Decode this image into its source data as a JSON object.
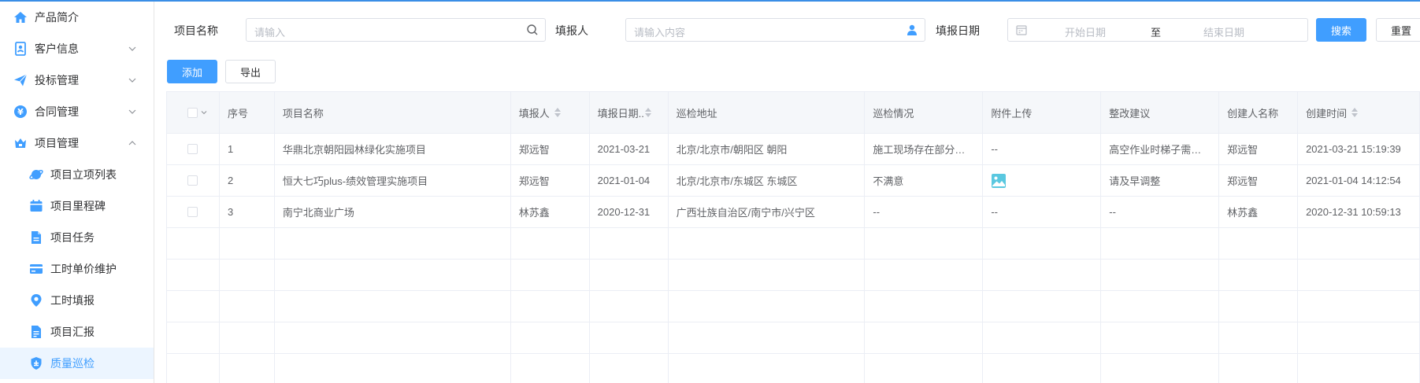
{
  "sidebar": {
    "items": [
      {
        "label": "产品简介",
        "icon": "home-icon",
        "expandable": false
      },
      {
        "label": "客户信息",
        "icon": "contact-card-icon",
        "expandable": true
      },
      {
        "label": "投标管理",
        "icon": "paper-plane-icon",
        "expandable": true
      },
      {
        "label": "合同管理",
        "icon": "yen-icon",
        "expandable": true
      },
      {
        "label": "项目管理",
        "icon": "crown-box-icon",
        "expandable": true,
        "expanded": true
      }
    ],
    "subitems": [
      {
        "label": "项目立项列表",
        "icon": "planet-icon"
      },
      {
        "label": "项目里程碑",
        "icon": "calendar-icon"
      },
      {
        "label": "项目任务",
        "icon": "document-icon"
      },
      {
        "label": "工时单价维护",
        "icon": "credit-card-icon"
      },
      {
        "label": "工时填报",
        "icon": "location-pin-icon"
      },
      {
        "label": "项目汇报",
        "icon": "report-icon"
      },
      {
        "label": "质量巡检",
        "icon": "shield-icon",
        "active": true
      }
    ]
  },
  "filters": {
    "project_name_label": "项目名称",
    "project_name_placeholder": "请输入",
    "reporter_label": "填报人",
    "reporter_placeholder": "请输入内容",
    "date_label": "填报日期",
    "date_start_placeholder": "开始日期",
    "date_separator": "至",
    "date_end_placeholder": "结束日期",
    "search_button": "搜索",
    "reset_button": "重置"
  },
  "toolbar": {
    "add_button": "添加",
    "export_button": "导出"
  },
  "table": {
    "columns": [
      "序号",
      "项目名称",
      "填报人",
      "填报日期..",
      "巡检地址",
      "巡检情况",
      "附件上传",
      "整改建议",
      "创建人名称",
      "创建时间"
    ],
    "rows": [
      {
        "index": "1",
        "project": "华鼎北京朝阳园林绿化实施项目",
        "reporter": "郑远智",
        "date": "2021-03-21",
        "address": "北京/北京市/朝阳区 朝阳",
        "status": "施工现场存在部分…",
        "attachment": "--",
        "suggestion": "高空作业时梯子需…",
        "creator": "郑远智",
        "created": "2021-03-21 15:19:39"
      },
      {
        "index": "2",
        "project": "恒大七巧plus-绩效管理实施项目",
        "reporter": "郑远智",
        "date": "2021-01-04",
        "address": "北京/北京市/东城区 东城区",
        "status": "不满意",
        "attachment": "",
        "suggestion": "请及早调整",
        "creator": "郑远智",
        "created": "2021-01-04 14:12:54"
      },
      {
        "index": "3",
        "project": "南宁北商业广场",
        "reporter": "林苏鑫",
        "date": "2020-12-31",
        "address": "广西壮族自治区/南宁市/兴宁区",
        "status": "--",
        "attachment": "--",
        "suggestion": "--",
        "creator": "林苏鑫",
        "created": "2020-12-31 10:59:13"
      }
    ]
  },
  "colors": {
    "primary": "#409eff",
    "active_bg": "#ecf5ff",
    "icon_blue": "#409eff"
  }
}
